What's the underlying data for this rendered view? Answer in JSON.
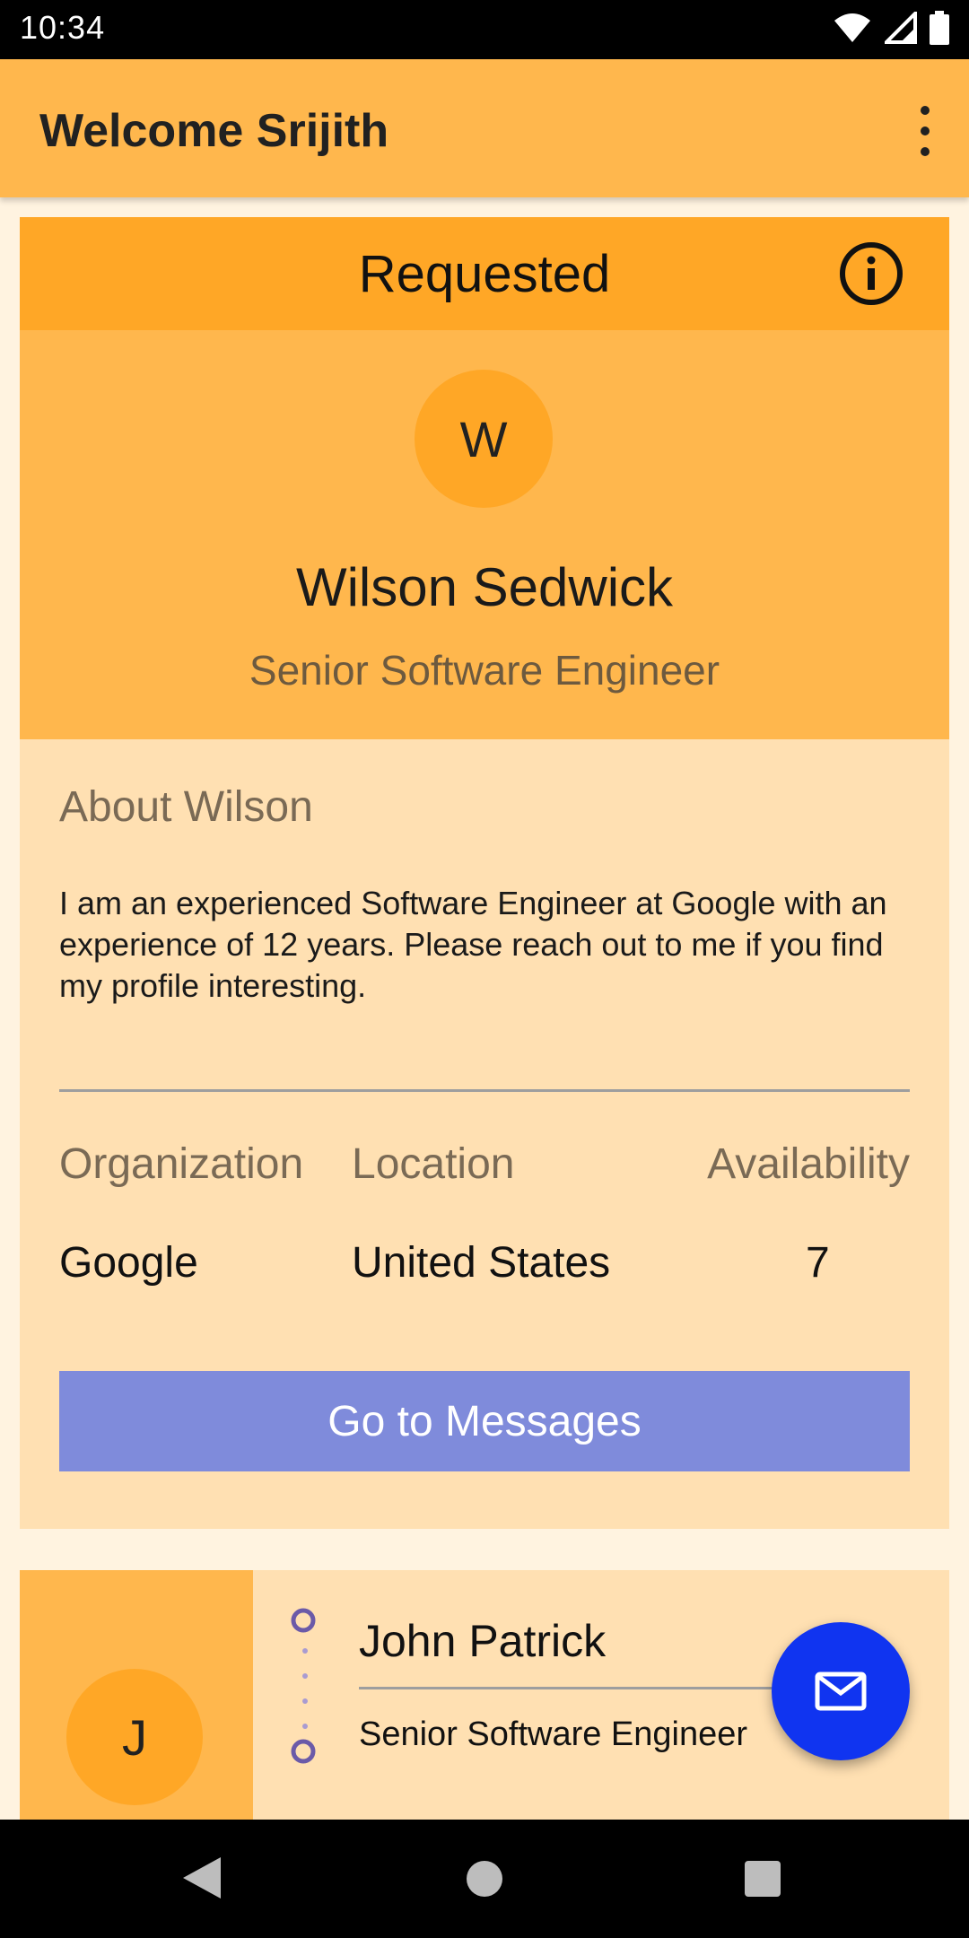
{
  "status_bar": {
    "time": "10:34",
    "icons": [
      "wifi-icon",
      "signal-icon",
      "battery-icon"
    ]
  },
  "app_bar": {
    "title": "Welcome Srijith",
    "overflow_icon": "more-vert-icon"
  },
  "card_requested": {
    "status": "Requested",
    "info_icon": "info-icon",
    "avatar_initial": "W",
    "name": "Wilson Sedwick",
    "role": "Senior Software Engineer",
    "about_title": "About Wilson",
    "about_text": "I am an experienced Software Engineer at Google with an experience of 12 years. Please reach out to me if you find my profile interesting.",
    "columns": [
      {
        "header": "Organization",
        "value": "Google"
      },
      {
        "header": "Location",
        "value": "United States"
      },
      {
        "header": "Availability",
        "value": "7"
      }
    ],
    "button_label": "Go to Messages"
  },
  "card_second": {
    "avatar_initial": "J",
    "name": "John Patrick",
    "role": "Senior Software Engineer"
  },
  "fab": {
    "icon": "mail-icon"
  },
  "nav_bar": {
    "icons": [
      "back-icon",
      "home-icon",
      "recents-icon"
    ]
  },
  "colors": {
    "app_bar": "#FFB74D",
    "header_accent": "#FFA726",
    "card_bg": "#FFE0B2",
    "page_bg": "#FFF3E0",
    "button": "#7F8BDB",
    "fab": "#1034F0"
  }
}
